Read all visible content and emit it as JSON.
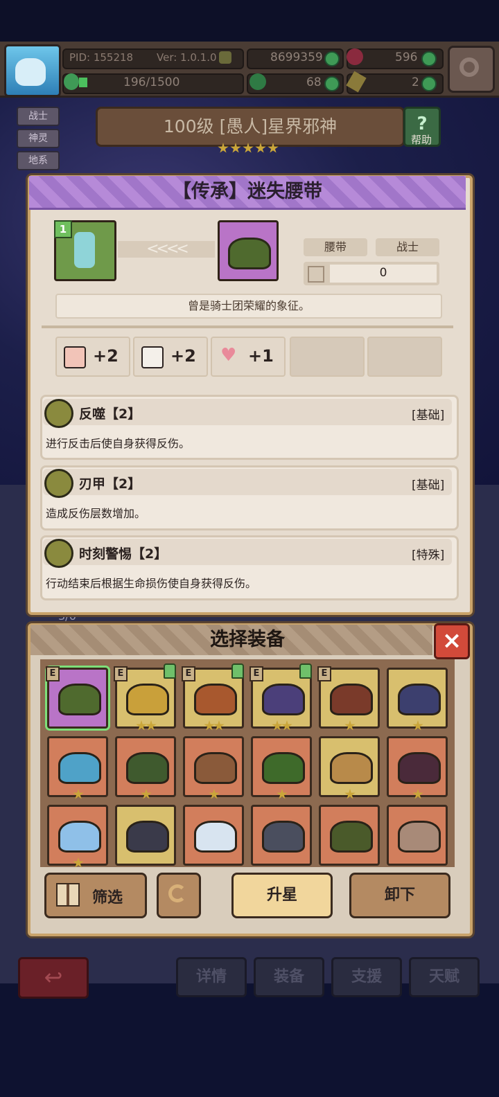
{
  "topbar": {
    "pid": "PID: 155218",
    "version": "Ver: 1.0.1.0",
    "exp": "196/1500",
    "currency_main": "8699359",
    "currency_gem": "596",
    "currency_clover": "68",
    "currency_key": "2"
  },
  "side_tabs": [
    "战士",
    "神灵",
    "地系"
  ],
  "boss": {
    "title": "100级 [愚人]星界邪神",
    "stars": 5,
    "help_label": "帮助"
  },
  "item_popup": {
    "title": "【传承】迷失腰带",
    "level_badge": "1",
    "arrows": "<<<<",
    "type_tag": "腰带",
    "class_tag": "战士",
    "count_value": "0",
    "description": "曾是骑士团荣耀的象征。",
    "stats": [
      {
        "icon": "fist-icon",
        "value": "+2"
      },
      {
        "icon": "book-icon",
        "value": "+2"
      },
      {
        "icon": "heart-icon",
        "value": "+1"
      }
    ],
    "skills": [
      {
        "name": "反噬【2】",
        "tag": "[基础]",
        "desc": "进行反击后使自身获得反伤。"
      },
      {
        "name": "刃甲【2】",
        "tag": "[基础]",
        "desc": "造成反伤层数增加。"
      },
      {
        "name": "时刻警惕【2】",
        "tag": "[特殊]",
        "desc": "行动结束后根据生命损伤使自身获得反伤。"
      }
    ]
  },
  "background_counter": "3/6",
  "select_panel": {
    "title": "选择装备",
    "close_label": "×",
    "equipped_tag": "E",
    "filter_label": "筛选",
    "upgrade_label": "升星",
    "unequip_label": "卸下",
    "items": [
      {
        "bg": "purple",
        "color": "#4f6a2e",
        "stars": 0,
        "equipped": true,
        "selected": true,
        "thumb": false
      },
      {
        "bg": "gold",
        "color": "#c9a03a",
        "stars": 2,
        "equipped": true,
        "selected": false,
        "thumb": true
      },
      {
        "bg": "gold",
        "color": "#a8582e",
        "stars": 2,
        "equipped": true,
        "selected": false,
        "thumb": true
      },
      {
        "bg": "gold",
        "color": "#4b3f7a",
        "stars": 2,
        "equipped": true,
        "selected": false,
        "thumb": true
      },
      {
        "bg": "gold",
        "color": "#7a3a2a",
        "stars": 1,
        "equipped": true,
        "selected": false,
        "thumb": false
      },
      {
        "bg": "gold",
        "color": "#3c3f6e",
        "stars": 1,
        "equipped": false,
        "selected": false,
        "thumb": false
      },
      {
        "bg": "orange",
        "color": "#4fa2c8",
        "stars": 1,
        "equipped": false,
        "selected": false,
        "thumb": false
      },
      {
        "bg": "orange",
        "color": "#3f5a2e",
        "stars": 1,
        "equipped": false,
        "selected": false,
        "thumb": false
      },
      {
        "bg": "orange",
        "color": "#8a5a3a",
        "stars": 1,
        "equipped": false,
        "selected": false,
        "thumb": false
      },
      {
        "bg": "orange",
        "color": "#3e6a2a",
        "stars": 1,
        "equipped": false,
        "selected": false,
        "thumb": false
      },
      {
        "bg": "gold",
        "color": "#b88a4a",
        "stars": 1,
        "equipped": false,
        "selected": false,
        "thumb": false
      },
      {
        "bg": "orange",
        "color": "#4a2a3a",
        "stars": 1,
        "equipped": false,
        "selected": false,
        "thumb": false
      },
      {
        "bg": "orange",
        "color": "#8fc0e8",
        "stars": 1,
        "equipped": false,
        "selected": false,
        "thumb": false
      },
      {
        "bg": "gold",
        "color": "#3a3a4a",
        "stars": 0,
        "equipped": false,
        "selected": false,
        "thumb": false
      },
      {
        "bg": "orange",
        "color": "#d8e4f0",
        "stars": 0,
        "equipped": false,
        "selected": false,
        "thumb": false
      },
      {
        "bg": "orange",
        "color": "#4a4e5e",
        "stars": 0,
        "equipped": false,
        "selected": false,
        "thumb": false
      },
      {
        "bg": "orange",
        "color": "#4a5a2a",
        "stars": 0,
        "equipped": false,
        "selected": false,
        "thumb": false
      },
      {
        "bg": "orange",
        "color": "#a88a78",
        "stars": 0,
        "equipped": false,
        "selected": false,
        "thumb": false
      }
    ]
  },
  "bottom_nav": {
    "back": "↩",
    "tabs": [
      "详情",
      "装备",
      "支援",
      "天赋"
    ]
  },
  "colors": {
    "accent_purple": "#b68ad8",
    "panel_bg": "#e6dccf",
    "border_gold": "#c9a36a"
  }
}
